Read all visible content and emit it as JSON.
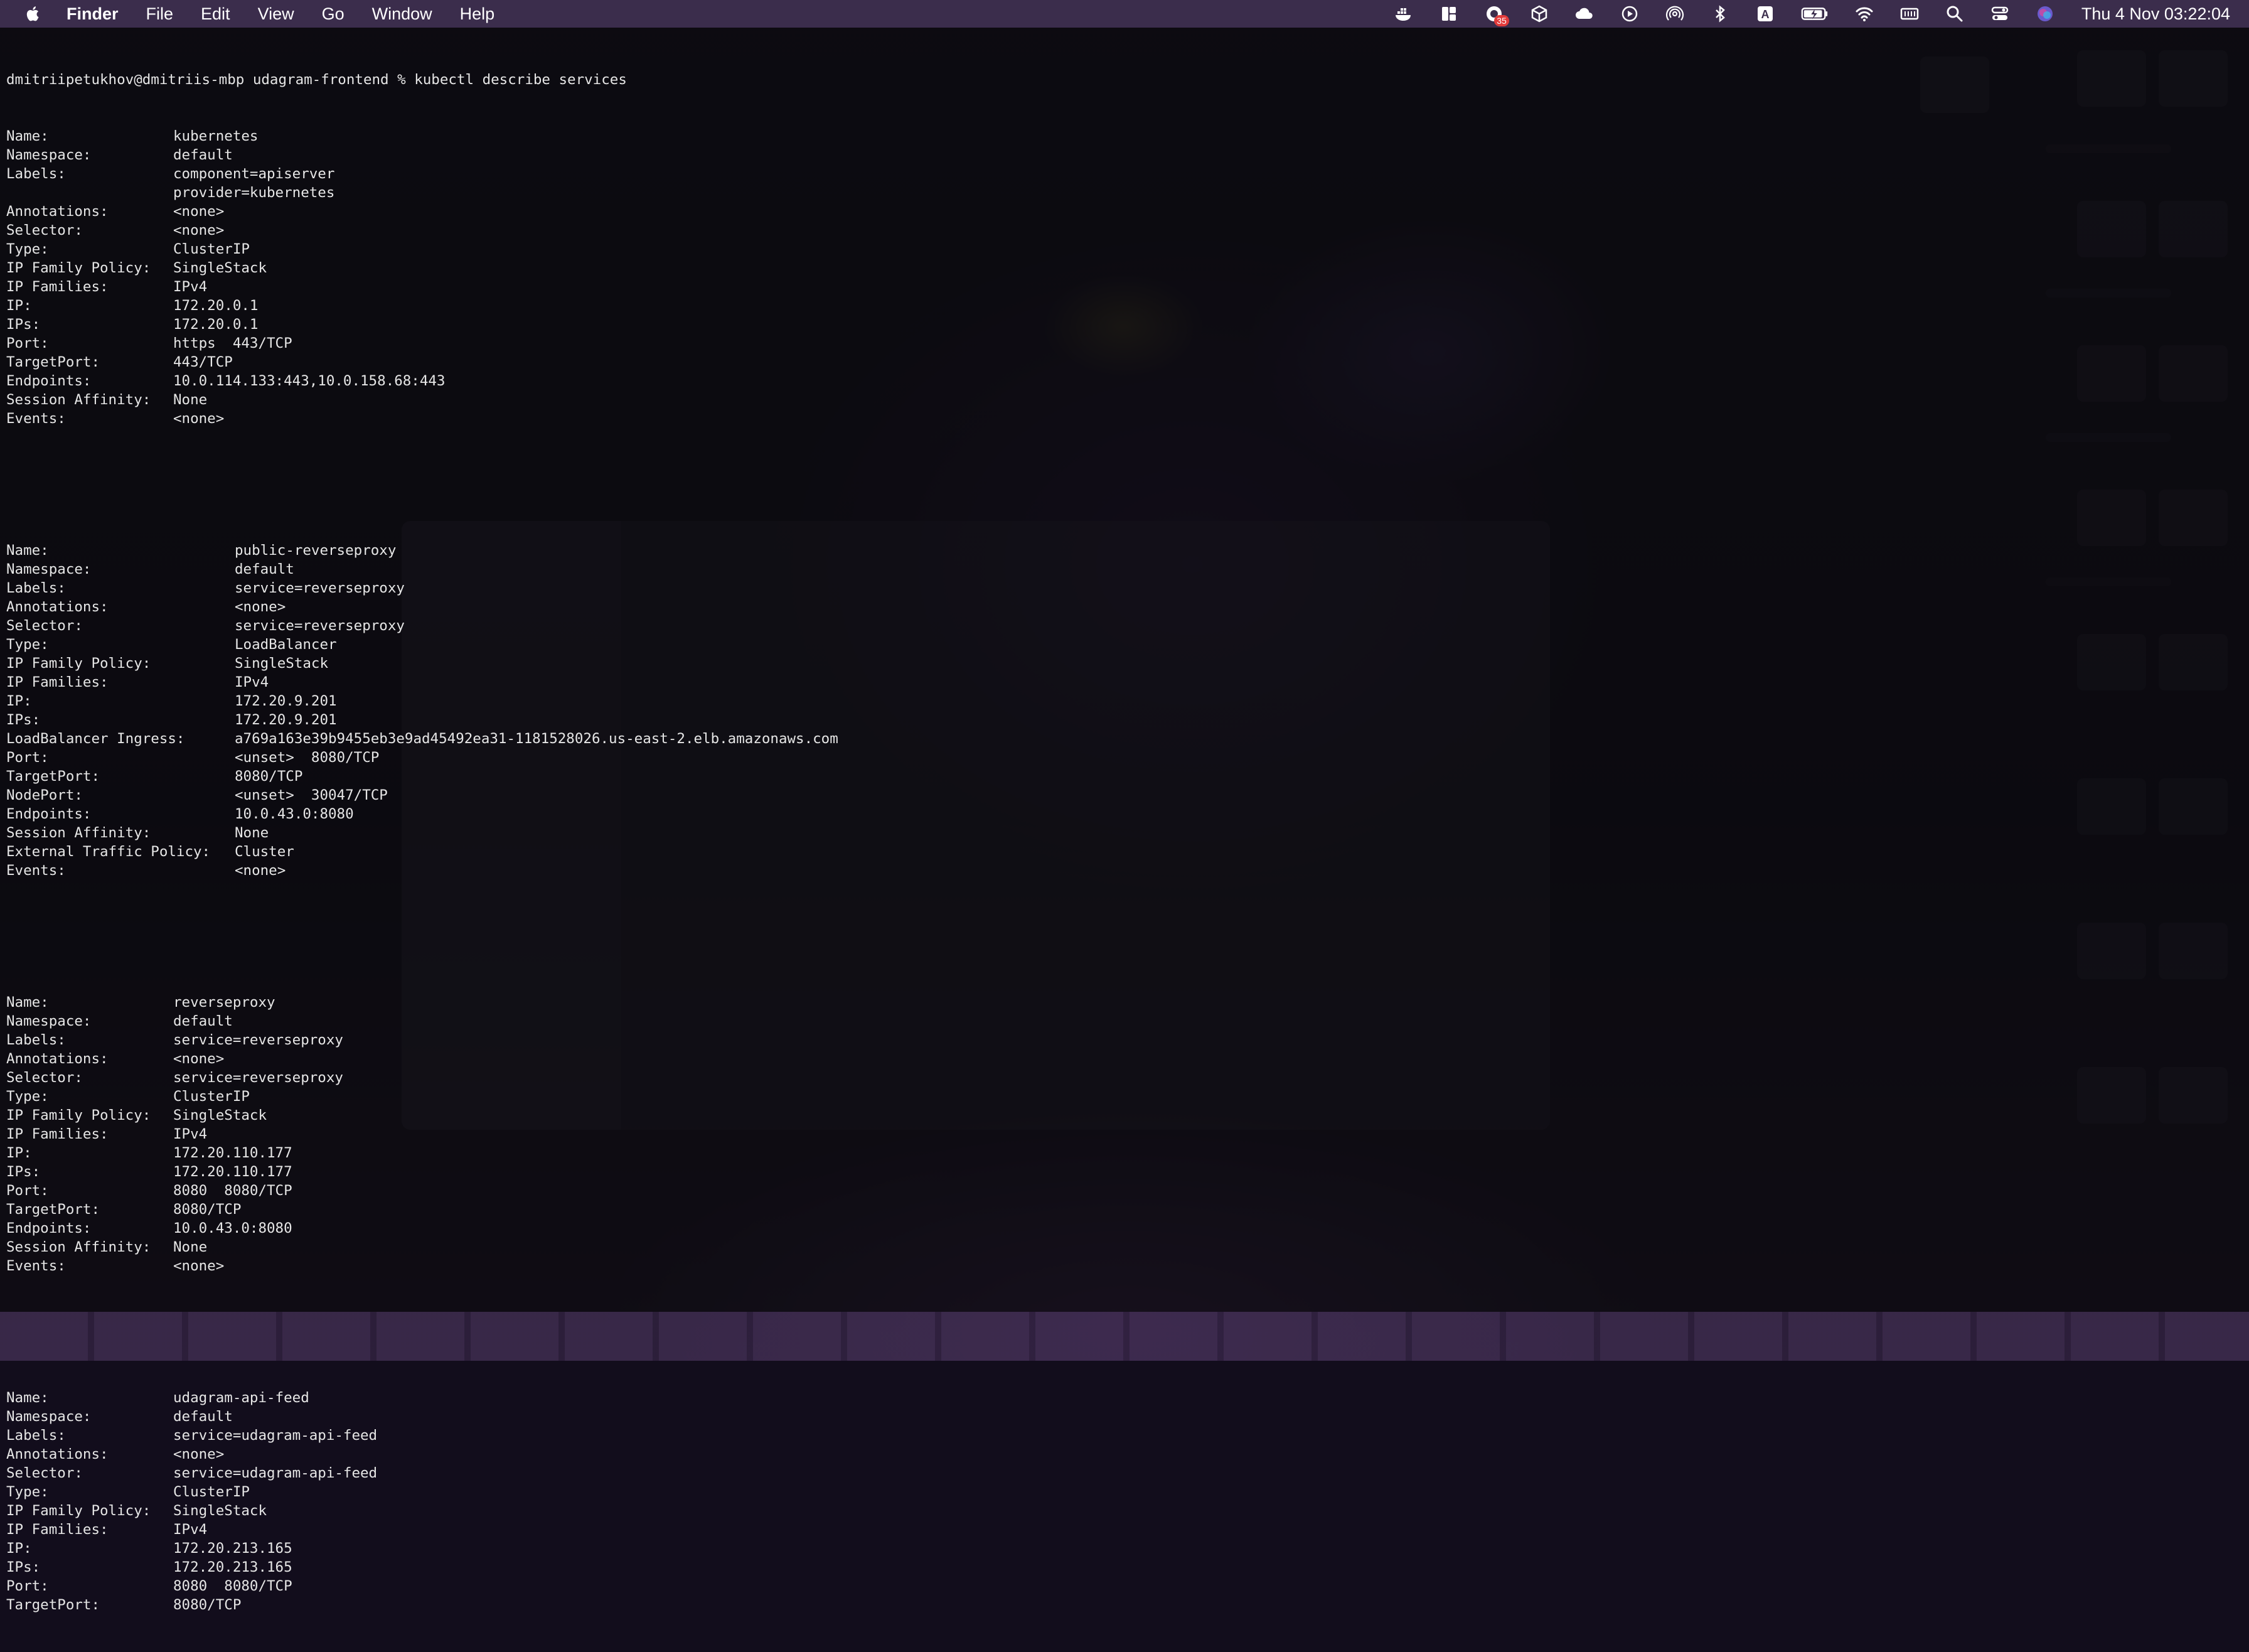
{
  "menubar": {
    "app_name": "Finder",
    "menus": [
      "File",
      "Edit",
      "View",
      "Go",
      "Window",
      "Help"
    ],
    "status_icons": [
      "docker-icon",
      "layout-icon",
      "notification-app-icon",
      "package-icon",
      "cloud-icon",
      "play-circle-icon",
      "airdrop-icon",
      "bluetooth-icon",
      "input-source-icon",
      "battery-icon",
      "wifi-icon",
      "memory-icon",
      "spotlight-search-icon",
      "control-center-icon",
      "siri-icon"
    ],
    "badge_count": "35",
    "input_source_letter": "A",
    "clock": "Thu 4 Nov  03:22:04"
  },
  "terminal": {
    "prompt": "dmitriipetukhov@dmitriis-mbp udagram-frontend % kubectl describe services",
    "services": [
      {
        "rows": [
          {
            "k": "Name:",
            "v": "kubernetes"
          },
          {
            "k": "Namespace:",
            "v": "default"
          },
          {
            "k": "Labels:",
            "v": "component=apiserver"
          },
          {
            "k": "",
            "v": "provider=kubernetes"
          },
          {
            "k": "Annotations:",
            "v": "<none>"
          },
          {
            "k": "Selector:",
            "v": "<none>"
          },
          {
            "k": "Type:",
            "v": "ClusterIP"
          },
          {
            "k": "IP Family Policy:",
            "v": "SingleStack"
          },
          {
            "k": "IP Families:",
            "v": "IPv4"
          },
          {
            "k": "IP:",
            "v": "172.20.0.1"
          },
          {
            "k": "IPs:",
            "v": "172.20.0.1"
          },
          {
            "k": "Port:",
            "v": "https  443/TCP"
          },
          {
            "k": "TargetPort:",
            "v": "443/TCP"
          },
          {
            "k": "Endpoints:",
            "v": "10.0.114.133:443,10.0.158.68:443"
          },
          {
            "k": "Session Affinity:",
            "v": "None"
          },
          {
            "k": "Events:",
            "v": "<none>"
          }
        ]
      },
      {
        "rows": [
          {
            "k": "Name:",
            "v": "public-reverseproxy"
          },
          {
            "k": "Namespace:",
            "v": "default"
          },
          {
            "k": "Labels:",
            "v": "service=reverseproxy"
          },
          {
            "k": "Annotations:",
            "v": "<none>"
          },
          {
            "k": "Selector:",
            "v": "service=reverseproxy"
          },
          {
            "k": "Type:",
            "v": "LoadBalancer"
          },
          {
            "k": "IP Family Policy:",
            "v": "SingleStack"
          },
          {
            "k": "IP Families:",
            "v": "IPv4"
          },
          {
            "k": "IP:",
            "v": "172.20.9.201"
          },
          {
            "k": "IPs:",
            "v": "172.20.9.201"
          },
          {
            "k": "LoadBalancer Ingress:",
            "v": "a769a163e39b9455eb3e9ad45492ea31-1181528026.us-east-2.elb.amazonaws.com"
          },
          {
            "k": "Port:",
            "v": "<unset>  8080/TCP"
          },
          {
            "k": "TargetPort:",
            "v": "8080/TCP"
          },
          {
            "k": "NodePort:",
            "v": "<unset>  30047/TCP"
          },
          {
            "k": "Endpoints:",
            "v": "10.0.43.0:8080"
          },
          {
            "k": "Session Affinity:",
            "v": "None"
          },
          {
            "k": "External Traffic Policy:",
            "v": "Cluster"
          },
          {
            "k": "Events:",
            "v": "<none>"
          }
        ]
      },
      {
        "rows": [
          {
            "k": "Name:",
            "v": "reverseproxy"
          },
          {
            "k": "Namespace:",
            "v": "default"
          },
          {
            "k": "Labels:",
            "v": "service=reverseproxy"
          },
          {
            "k": "Annotations:",
            "v": "<none>"
          },
          {
            "k": "Selector:",
            "v": "service=reverseproxy"
          },
          {
            "k": "Type:",
            "v": "ClusterIP"
          },
          {
            "k": "IP Family Policy:",
            "v": "SingleStack"
          },
          {
            "k": "IP Families:",
            "v": "IPv4"
          },
          {
            "k": "IP:",
            "v": "172.20.110.177"
          },
          {
            "k": "IPs:",
            "v": "172.20.110.177"
          },
          {
            "k": "Port:",
            "v": "8080  8080/TCP"
          },
          {
            "k": "TargetPort:",
            "v": "8080/TCP"
          },
          {
            "k": "Endpoints:",
            "v": "10.0.43.0:8080"
          },
          {
            "k": "Session Affinity:",
            "v": "None"
          },
          {
            "k": "Events:",
            "v": "<none>"
          }
        ]
      },
      {
        "rows": [
          {
            "k": "Name:",
            "v": "udagram-api-feed"
          },
          {
            "k": "Namespace:",
            "v": "default"
          },
          {
            "k": "Labels:",
            "v": "service=udagram-api-feed"
          },
          {
            "k": "Annotations:",
            "v": "<none>"
          },
          {
            "k": "Selector:",
            "v": "service=udagram-api-feed"
          },
          {
            "k": "Type:",
            "v": "ClusterIP"
          },
          {
            "k": "IP Family Policy:",
            "v": "SingleStack"
          },
          {
            "k": "IP Families:",
            "v": "IPv4"
          },
          {
            "k": "IP:",
            "v": "172.20.213.165"
          },
          {
            "k": "IPs:",
            "v": "172.20.213.165"
          },
          {
            "k": "Port:",
            "v": "8080  8080/TCP"
          },
          {
            "k": "TargetPort:",
            "v": "8080/TCP"
          }
        ]
      }
    ]
  }
}
